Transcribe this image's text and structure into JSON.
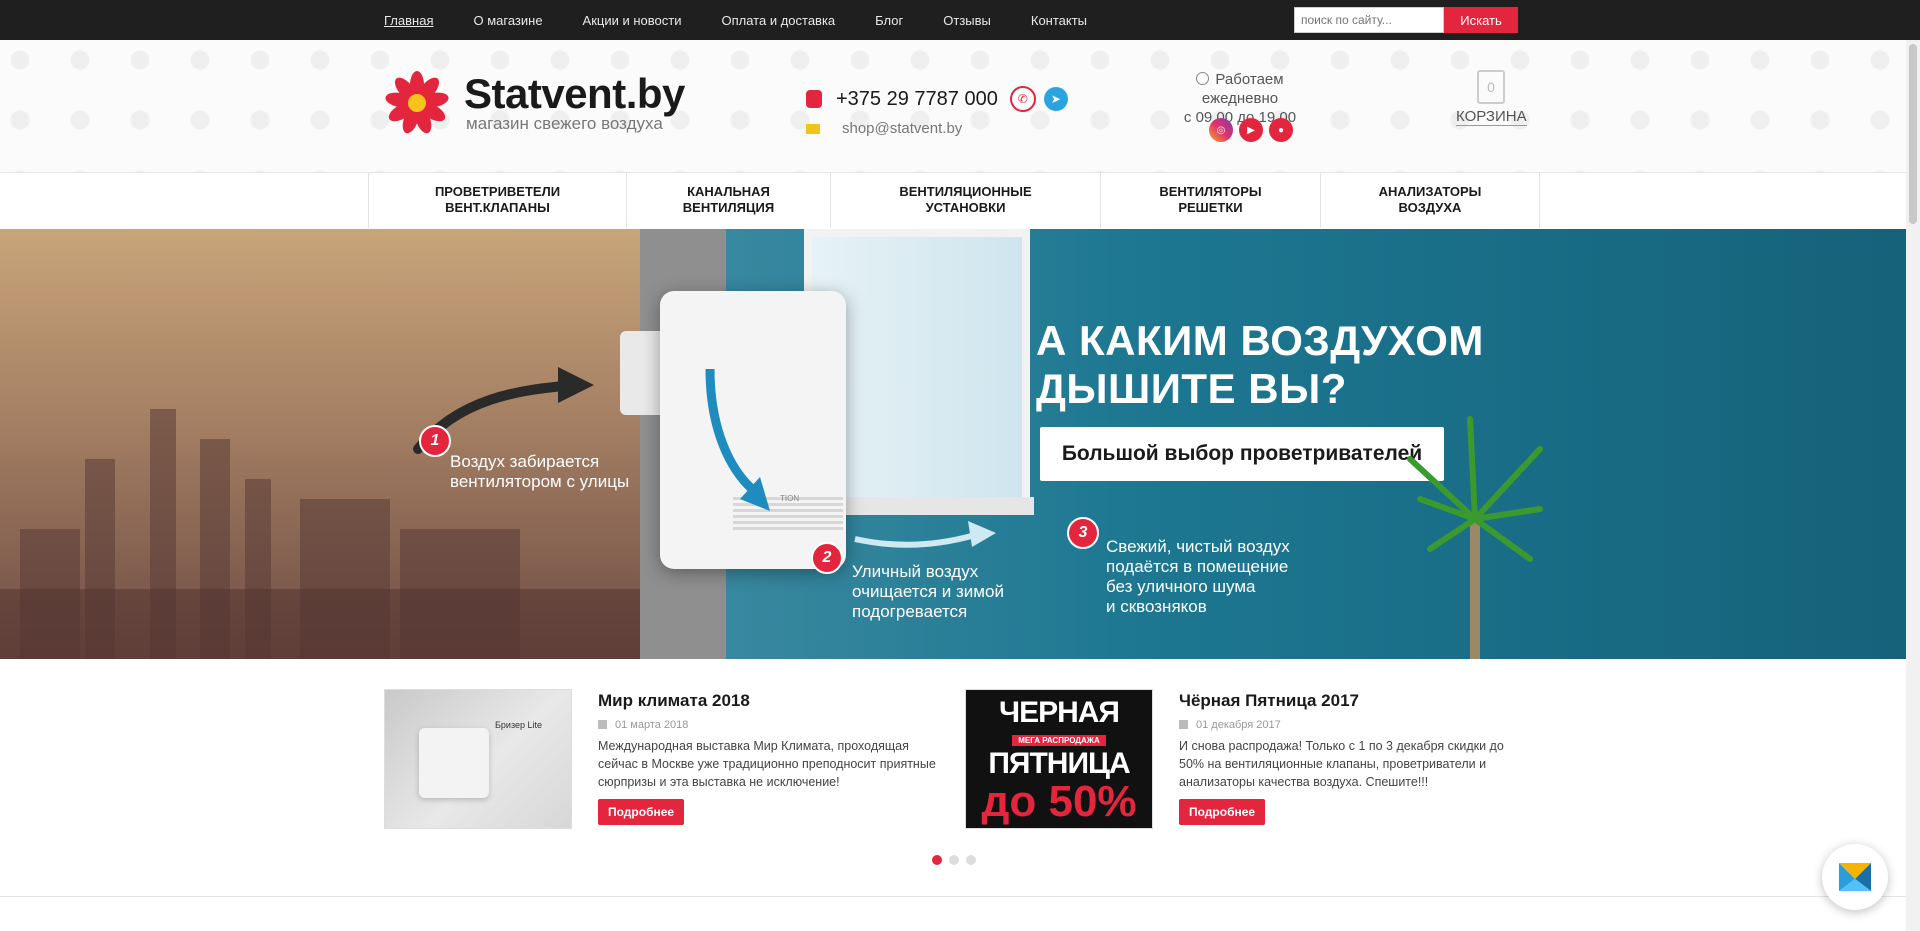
{
  "topnav": {
    "items": [
      "Главная",
      "О магазине",
      "Акции и новости",
      "Оплата и доставка",
      "Блог",
      "Отзывы",
      "Контакты"
    ]
  },
  "search": {
    "placeholder": "поиск по сайту...",
    "button": "Искать"
  },
  "logo": {
    "name": "Statvent.by",
    "tagline": "магазин свежего воздуха"
  },
  "contacts": {
    "phone": "+375 29 7787 000",
    "email": "shop@statvent.by"
  },
  "hours": {
    "line1": "Работаем ежедневно",
    "line2": "с 09.00 до 19.00"
  },
  "cart": {
    "count": "0",
    "label": "КОРЗИНА"
  },
  "catnav": {
    "items": [
      {
        "line1": "ПРОВЕТРИВЕТЕЛИ",
        "line2": "ВЕНТ.КЛАПАНЫ"
      },
      {
        "line1": "КАНАЛЬНАЯ",
        "line2": "ВЕНТИЛЯЦИЯ"
      },
      {
        "line1": "ВЕНТИЛЯЦИОННЫЕ",
        "line2": "УСТАНОВКИ"
      },
      {
        "line1": "ВЕНТИЛЯТОРЫ",
        "line2": "РЕШЕТКИ"
      },
      {
        "line1": "АНАЛИЗАТОРЫ",
        "line2": "ВОЗДУХА"
      }
    ]
  },
  "banner": {
    "title_line1": "А КАКИМ ВОЗДУХОМ",
    "title_line2": "ДЫШИТЕ ВЫ?",
    "button": "Большой выбор проветривателей",
    "steps": [
      {
        "num": "1",
        "line1": "Воздух забирается",
        "line2": "вентилятором с улицы"
      },
      {
        "num": "2",
        "line1": "Уличный воздух",
        "line2": "очищается и зимой",
        "line3": "подогревается"
      },
      {
        "num": "3",
        "line1": "Свежий, чистый воздух",
        "line2": "подаётся в помещение",
        "line3": "без уличного шума",
        "line4": "и сквозняков"
      }
    ],
    "device_label": "TION"
  },
  "news": [
    {
      "title": "Мир климата 2018",
      "date": "01 марта 2018",
      "text": "Международная выставка Мир Климата, проходящая сейчас в Москве уже традиционно преподносит приятные сюрпризы и эта выставка не исключение!",
      "button": "Подробнее",
      "image_caption": "Бризер Lite"
    },
    {
      "title": "Чёрная Пятница 2017",
      "date": "01 декабря 2017",
      "text": "И снова распродажа! Только с 1 по 3 декабря скидки до 50% на вентиляционные клапаны, проветриватели и анализаторы качества воздуха. Спешите!!!",
      "button": "Подробнее",
      "image_text": {
        "l1": "ЧЕРНАЯ",
        "l2": "МЕГА РАСПРОДАЖА",
        "l3": "ПЯТНИЦА",
        "l4": "до 50%"
      }
    }
  ],
  "carousel": {
    "active": 1,
    "total": 3
  },
  "colors": {
    "accent": "#e3263d",
    "topbar": "#1f1f1f",
    "banner_teal": "#1d7791"
  }
}
